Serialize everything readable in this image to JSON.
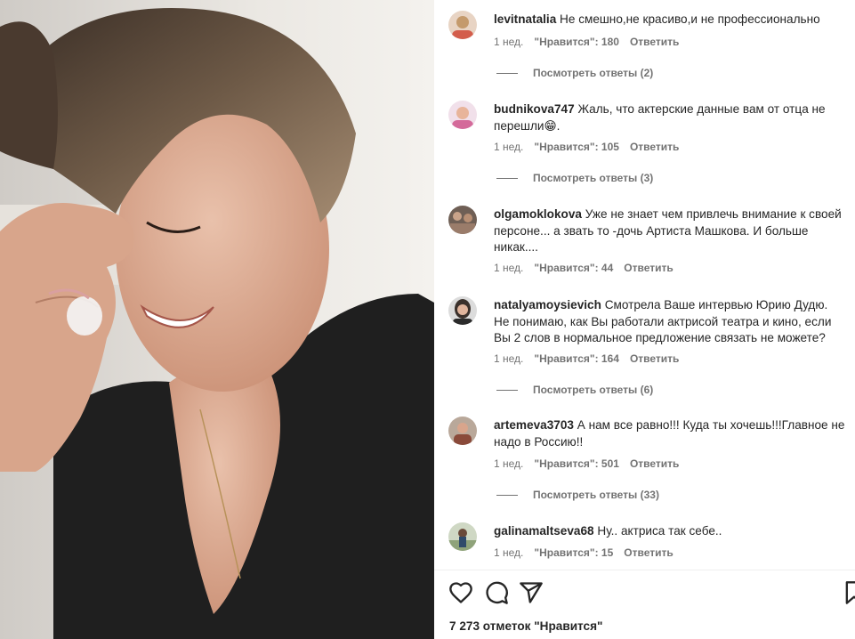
{
  "post": {
    "likes_text": "7 273 отметок \"Нравится\""
  },
  "comments": [
    {
      "username": "levitnatalia",
      "text": "Не смешно,не красиво,и не профессионально",
      "time": "1 нед.",
      "likes": "\"Нравится\": 180",
      "reply": "Ответить",
      "view_replies": "Посмотреть ответы (2)",
      "avatar_color": "#c49a6c"
    },
    {
      "username": "budnikova747",
      "text": "Жаль, что актерские данные вам от отца не перешли😁.",
      "time": "1 нед.",
      "likes": "\"Нравится\": 105",
      "reply": "Ответить",
      "view_replies": "Посмотреть ответы (3)",
      "avatar_color": "#d46a9a"
    },
    {
      "username": "olgamoklokova",
      "text": "Уже не знает чем привлечь внимание к своей персоне... а звать то -дочь Артиста Машкова. И больше никак....",
      "time": "1 нед.",
      "likes": "\"Нравится\": 44",
      "reply": "Ответить",
      "view_replies": "",
      "avatar_color": "#7a6a5e"
    },
    {
      "username": "natalyamoysievich",
      "text": "Смотрела Ваше интервью Юрию Дудю. Не понимаю, как Вы работали актрисой театра и кино, если Вы 2 слов в нормальное предложение связать не можете?",
      "time": "1 нед.",
      "likes": "\"Нравится\": 164",
      "reply": "Ответить",
      "view_replies": "Посмотреть ответы (6)",
      "avatar_color": "#4a3f3a"
    },
    {
      "username": "artemeva3703",
      "text": "А нам все равно!!! Куда ты хочешь!!!Главное не надо в Россию!!",
      "time": "1 нед.",
      "likes": "\"Нравится\": 501",
      "reply": "Ответить",
      "view_replies": "Посмотреть ответы (33)",
      "avatar_color": "#8a4a3a"
    },
    {
      "username": "galinamaltseva68",
      "text": "Ну.. актриса так себе..",
      "time": "1 нед.",
      "likes": "\"Нравится\": 15",
      "reply": "Ответить",
      "view_replies": "",
      "avatar_color": "#5b7a4a"
    }
  ],
  "icons": {
    "like": "heart-icon",
    "comment": "comment-icon",
    "share": "share-icon",
    "save": "bookmark-icon"
  }
}
